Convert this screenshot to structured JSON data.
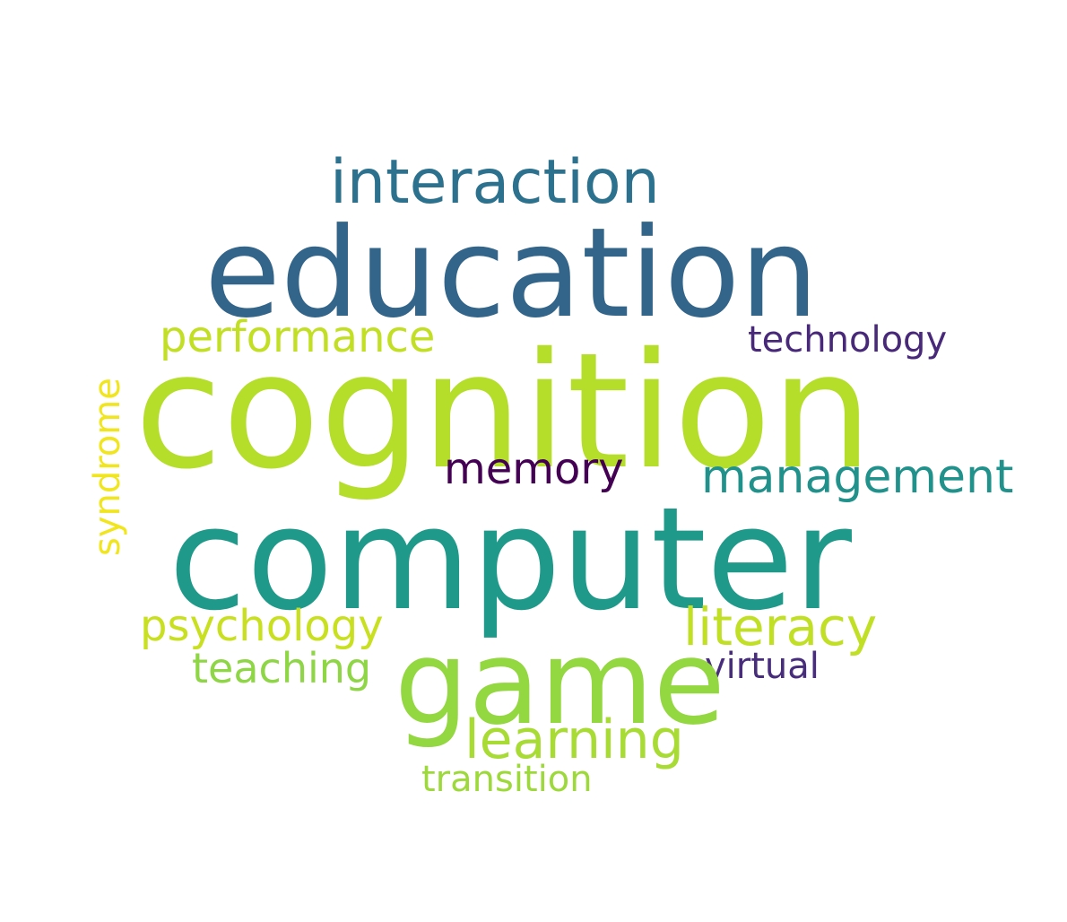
{
  "cloud": {
    "background": "#ffffff",
    "words": [
      {
        "id": "education",
        "text": "education",
        "color": "#33658a"
      },
      {
        "id": "cognition",
        "text": "cognition",
        "color": "#b5de2b"
      },
      {
        "id": "computer",
        "text": "computer",
        "color": "#1f9a8a"
      },
      {
        "id": "game",
        "text": "game",
        "color": "#93d741"
      },
      {
        "id": "interaction",
        "text": "interaction",
        "color": "#2c718e"
      },
      {
        "id": "performance",
        "text": "performance",
        "color": "#c2df23"
      },
      {
        "id": "technology",
        "text": "technology",
        "color": "#482878"
      },
      {
        "id": "memory",
        "text": "memory",
        "color": "#440154"
      },
      {
        "id": "management",
        "text": "management",
        "color": "#21918c"
      },
      {
        "id": "psychology",
        "text": "psychology",
        "color": "#c8e020"
      },
      {
        "id": "literacy",
        "text": "literacy",
        "color": "#c0df25"
      },
      {
        "id": "teaching",
        "text": "teaching",
        "color": "#8ed645"
      },
      {
        "id": "virtual",
        "text": "virtual",
        "color": "#472d7b"
      },
      {
        "id": "learning",
        "text": "learning",
        "color": "#a8db34"
      },
      {
        "id": "transition",
        "text": "transition",
        "color": "#9dd93b"
      },
      {
        "id": "syndrome",
        "text": "syndrome",
        "color": "#f1e51d"
      }
    ]
  }
}
